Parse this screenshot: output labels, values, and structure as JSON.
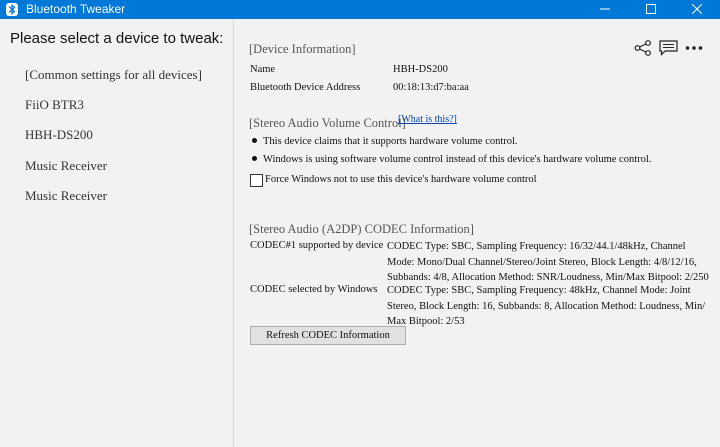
{
  "window": {
    "title": "Bluetooth Tweaker"
  },
  "sidebar": {
    "header": "Please select a device to tweak:",
    "devices": [
      "[Common settings for all devices]",
      "FiiO BTR3",
      "HBH-DS200",
      "Music Receiver",
      "Music Receiver"
    ]
  },
  "device_info": {
    "section_title": "[Device Information]",
    "name_label": "Name",
    "name_value": "HBH-DS200",
    "address_label": "Bluetooth Device Address",
    "address_value": "00:18:13:d7:ba:aa"
  },
  "volume": {
    "section_title": "[Stereo Audio Volume Control]",
    "help_link": "[What is this?]",
    "bullet1": "This device claims that it supports hardware volume control.",
    "bullet2": "Windows is using software volume control instead of this device's hardware volume control.",
    "checkbox_label": "Force Windows not to use this device's hardware volume control",
    "checkbox_checked": false
  },
  "codec": {
    "section_title": "[Stereo Audio (A2DP) CODEC Information]",
    "supported_label": "CODEC#1 supported by device",
    "supported_lines": [
      "CODEC Type: SBC, Sampling Frequency: 16/32/44.1/48kHz, Channel",
      "Mode: Mono/Dual Channel/Stereo/Joint Stereo, Block Length: 4/8/12/16,",
      "Subbands: 4/8, Allocation Method: SNR/Loudness, Min/Max Bitpool: 2/250"
    ],
    "selected_label": "CODEC selected by Windows",
    "selected_lines": [
      "CODEC Type: SBC, Sampling Frequency: 48kHz, Channel Mode: Joint",
      "Stereo, Block Length: 16, Subbands: 8, Allocation Method: Loudness, Min/",
      "Max Bitpool: 2/53"
    ],
    "refresh_button": "Refresh CODEC Information"
  },
  "icons": {
    "app": "bluetooth-icon",
    "share": "share-icon",
    "feedback": "feedback-icon",
    "more": "more-icon"
  },
  "colors": {
    "titlebar": "#0078d7",
    "link": "#0645ad",
    "panel": "#f2f2f2"
  }
}
